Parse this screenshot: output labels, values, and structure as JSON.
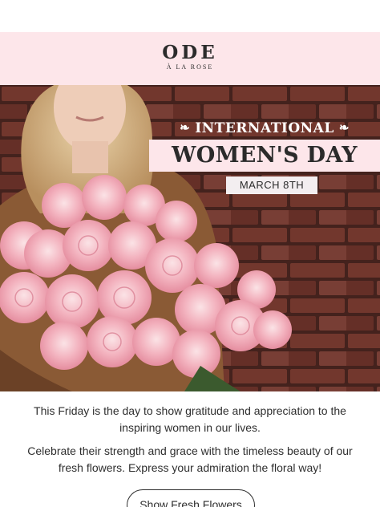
{
  "brand": {
    "logo_main": "ODE",
    "logo_sub": "À LA ROSE"
  },
  "banner": {
    "line1": "INTERNATIONAL",
    "line2": "WOMEN'S DAY",
    "date": "MARCH 8TH",
    "leaf_icon_left": "❧",
    "leaf_icon_right": "❧"
  },
  "body": {
    "paragraph1": "This Friday is the day to show gratitude and appreciation to the inspiring women in our lives.",
    "paragraph2": "Celebrate their strength and grace with the timeless beauty of our fresh flowers. Express your admiration the floral way!"
  },
  "cta": {
    "label": "Show Fresh Flowers"
  },
  "colors": {
    "header_bg": "#fde6ea",
    "brick": "#7a3b30",
    "rose": "#f4b8c3",
    "text": "#2f2f2f"
  }
}
